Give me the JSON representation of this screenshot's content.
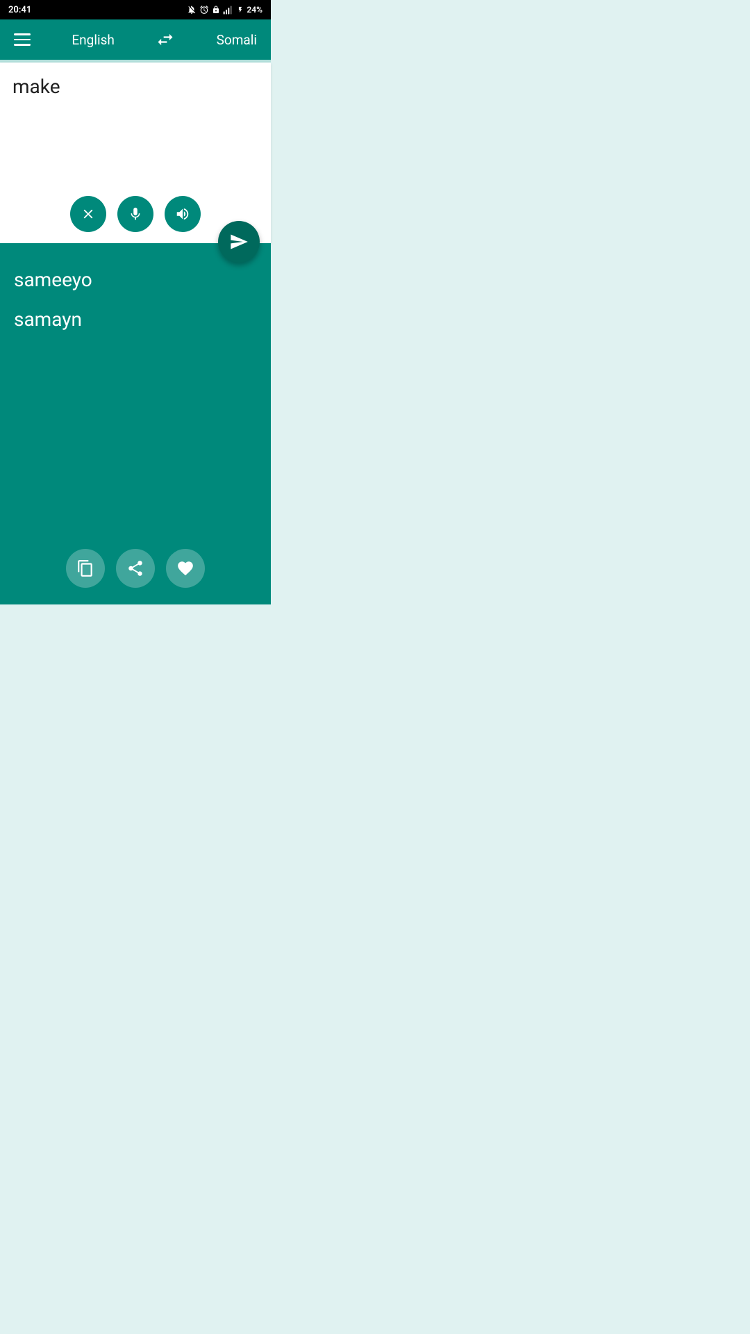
{
  "statusBar": {
    "time": "20:41",
    "icons": "🔕 ⏰ 🔒 📶 ⚡ 24%"
  },
  "header": {
    "menuLabel": "menu",
    "sourceLang": "English",
    "swapLabel": "swap languages",
    "targetLang": "Somali"
  },
  "inputArea": {
    "inputText": "make",
    "clearLabel": "clear",
    "micLabel": "microphone",
    "speakLabel": "speak",
    "sendLabel": "send"
  },
  "translationArea": {
    "word1": "sameeyo",
    "word2": "samayn",
    "copyLabel": "copy",
    "shareLabel": "share",
    "favoriteLabel": "favorite"
  }
}
